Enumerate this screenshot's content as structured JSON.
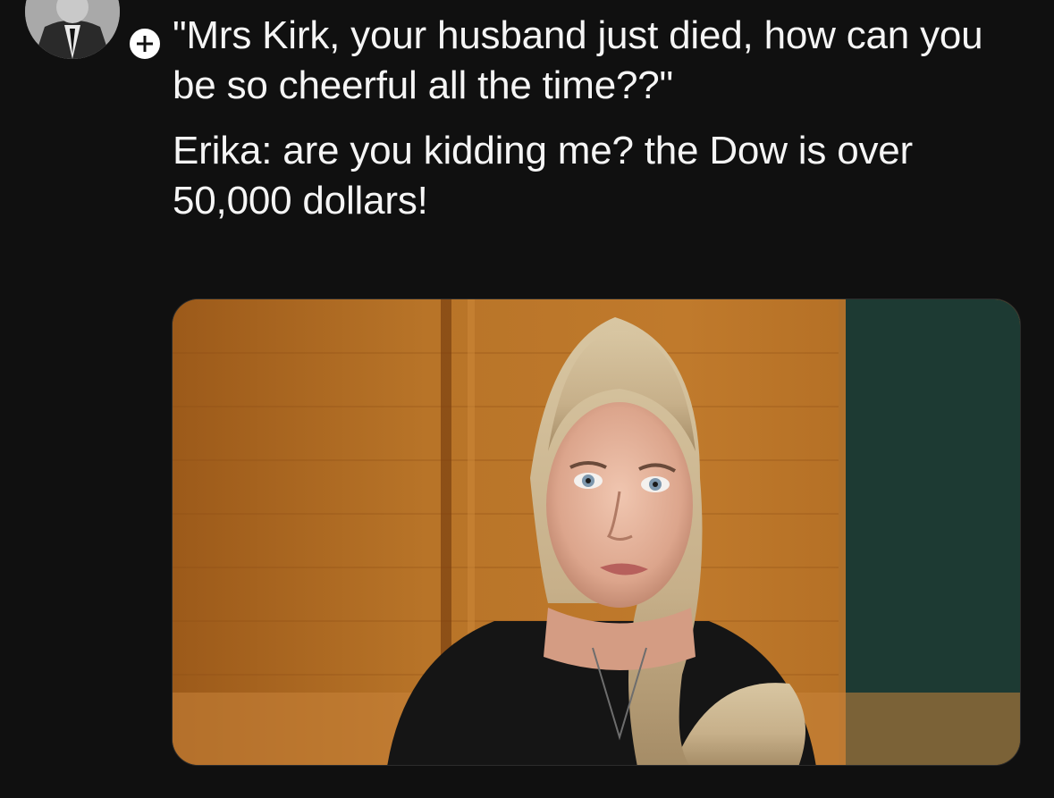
{
  "post": {
    "author_avatar_icon": "profile-photo",
    "follow_icon": "plus-icon",
    "text_lines": [
      "\"Mrs Kirk, your husband just died, how can you be so cheerful all the time??\"",
      "Erika: are you kidding me? the Dow is over 50,000 dollars!"
    ],
    "media_icon": "woman-portrait-photo"
  },
  "colors": {
    "background": "#101010",
    "text": "#f5f5f5",
    "badge": "#ffffff"
  }
}
